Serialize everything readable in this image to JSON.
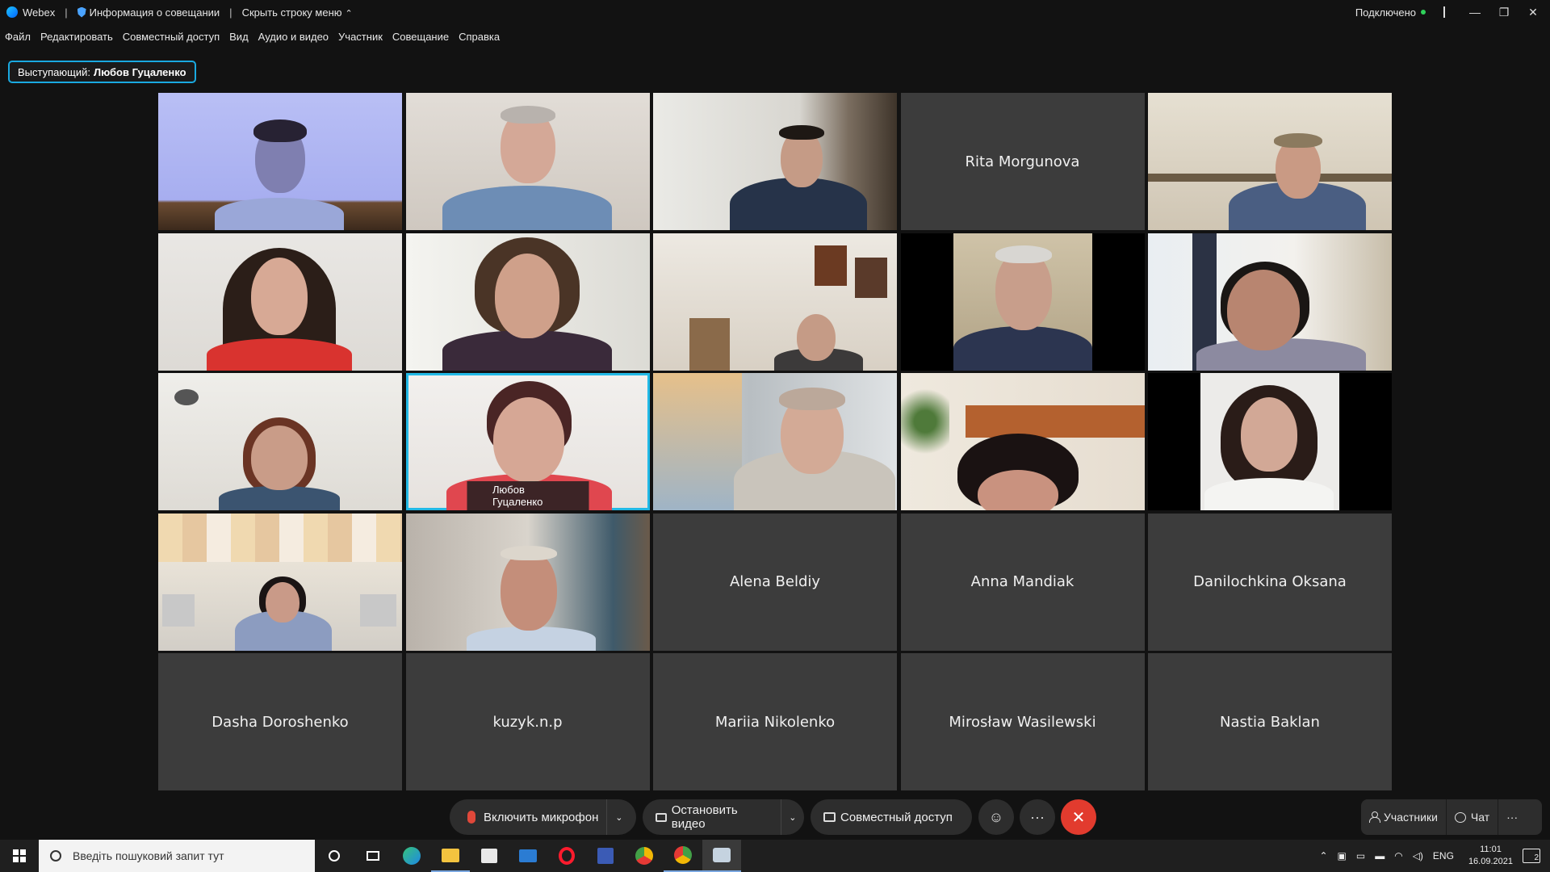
{
  "titlebar": {
    "app_name": "Webex",
    "meeting_info": "Информация о совещании",
    "hide_menu": "Скрыть строку меню",
    "status": "Подключено"
  },
  "menu": {
    "items": [
      "Файл",
      "Редактировать",
      "Совместный доступ",
      "Вид",
      "Аудио и видео",
      "Участник",
      "Совещание",
      "Справка"
    ]
  },
  "speaker": {
    "prefix": "Выступающий:",
    "name": "Любов Гуцаленко"
  },
  "tiles": [
    {
      "name": ""
    },
    {
      "name": ""
    },
    {
      "name": ""
    },
    {
      "name": "Rita Morgunova"
    },
    {
      "name": ""
    },
    {
      "name": ""
    },
    {
      "name": ""
    },
    {
      "name": ""
    },
    {
      "name": ""
    },
    {
      "name": ""
    },
    {
      "name": ""
    },
    {
      "name": "Любов Гуцаленко"
    },
    {
      "name": ""
    },
    {
      "name": ""
    },
    {
      "name": ""
    },
    {
      "name": ""
    },
    {
      "name": ""
    },
    {
      "name": "Alena Beldiy"
    },
    {
      "name": "Anna Mandiak"
    },
    {
      "name": "Danilochkina Oksana"
    },
    {
      "name": "Dasha Doroshenko"
    },
    {
      "name": "kuzyk.n.p"
    },
    {
      "name": "Mariia Nikolenko"
    },
    {
      "name": "Mirosław Wasilewski"
    },
    {
      "name": "Nastia Baklan"
    }
  ],
  "controls": {
    "mic": "Включить микрофон",
    "video": "Остановить видео",
    "share": "Совместный доступ",
    "more": "···",
    "participants": "Участники",
    "chat": "Чат",
    "panel_more": "···"
  },
  "taskbar": {
    "search_placeholder": "Введіть пошуковий запит тут",
    "lang": "ENG",
    "time": "11:01",
    "date": "16.09.2021",
    "notifications": "2"
  },
  "colors": {
    "accent": "#22b9e6",
    "end_call": "#e23b2e",
    "mic_muted": "#e0483a",
    "connected": "#2fd25a"
  }
}
